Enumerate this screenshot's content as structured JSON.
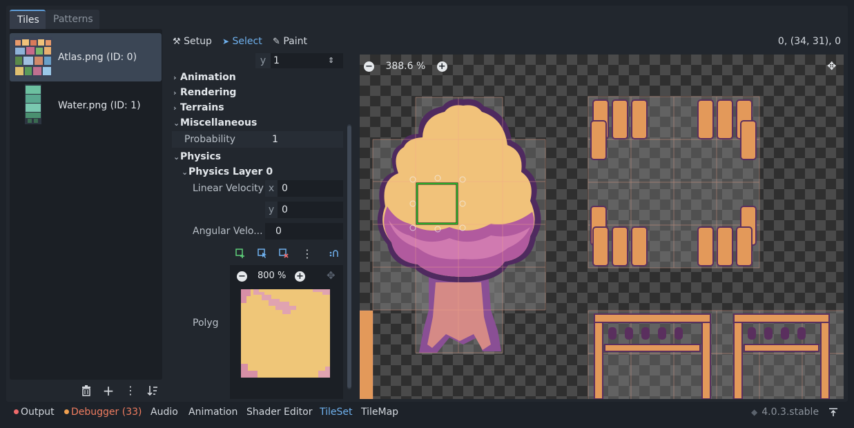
{
  "tabs": {
    "tiles": "Tiles",
    "patterns": "Patterns"
  },
  "sources": [
    {
      "label": "Atlas.png (ID: 0)",
      "selected": true
    },
    {
      "label": "Water.png (ID: 1)",
      "selected": false
    }
  ],
  "toolbar": {
    "setup": "Setup",
    "select": "Select",
    "paint": "Paint",
    "coords": "0, (34, 31), 0"
  },
  "inspector": {
    "y_axis": "y",
    "y_value": "1",
    "categories": {
      "animation": "Animation",
      "rendering": "Rendering",
      "terrains": "Terrains",
      "miscellaneous": "Miscellaneous",
      "physics": "Physics",
      "physics_layer": "Physics Layer 0"
    },
    "probability_label": "Probability",
    "probability_value": "1",
    "linear_velocity_label": "Linear Velocity",
    "lv_x_axis": "x",
    "lv_x_value": "0",
    "lv_y_axis": "y",
    "lv_y_value": "0",
    "angular_velocity_label": "Angular Velo...",
    "angular_velocity_value": "0",
    "polygon_label": "Polyg",
    "polygon_zoom": "800 %"
  },
  "canvas": {
    "zoom": "388.6 %"
  },
  "bottom_bar": {
    "output": "Output",
    "debugger": "Debugger (33)",
    "audio": "Audio",
    "animation": "Animation",
    "shader_editor": "Shader Editor",
    "tileset": "TileSet",
    "tilemap": "TileMap",
    "version": "4.0.3.stable"
  },
  "colors": {
    "accent": "#6fb1ee",
    "error_dot": "#f06b6b",
    "warning_dot": "#f0a050",
    "debugger_text": "#f07d60",
    "selection_green": "#2fd12f",
    "tile_orange": "#efc678",
    "tree_purple": "#a45a9a"
  }
}
